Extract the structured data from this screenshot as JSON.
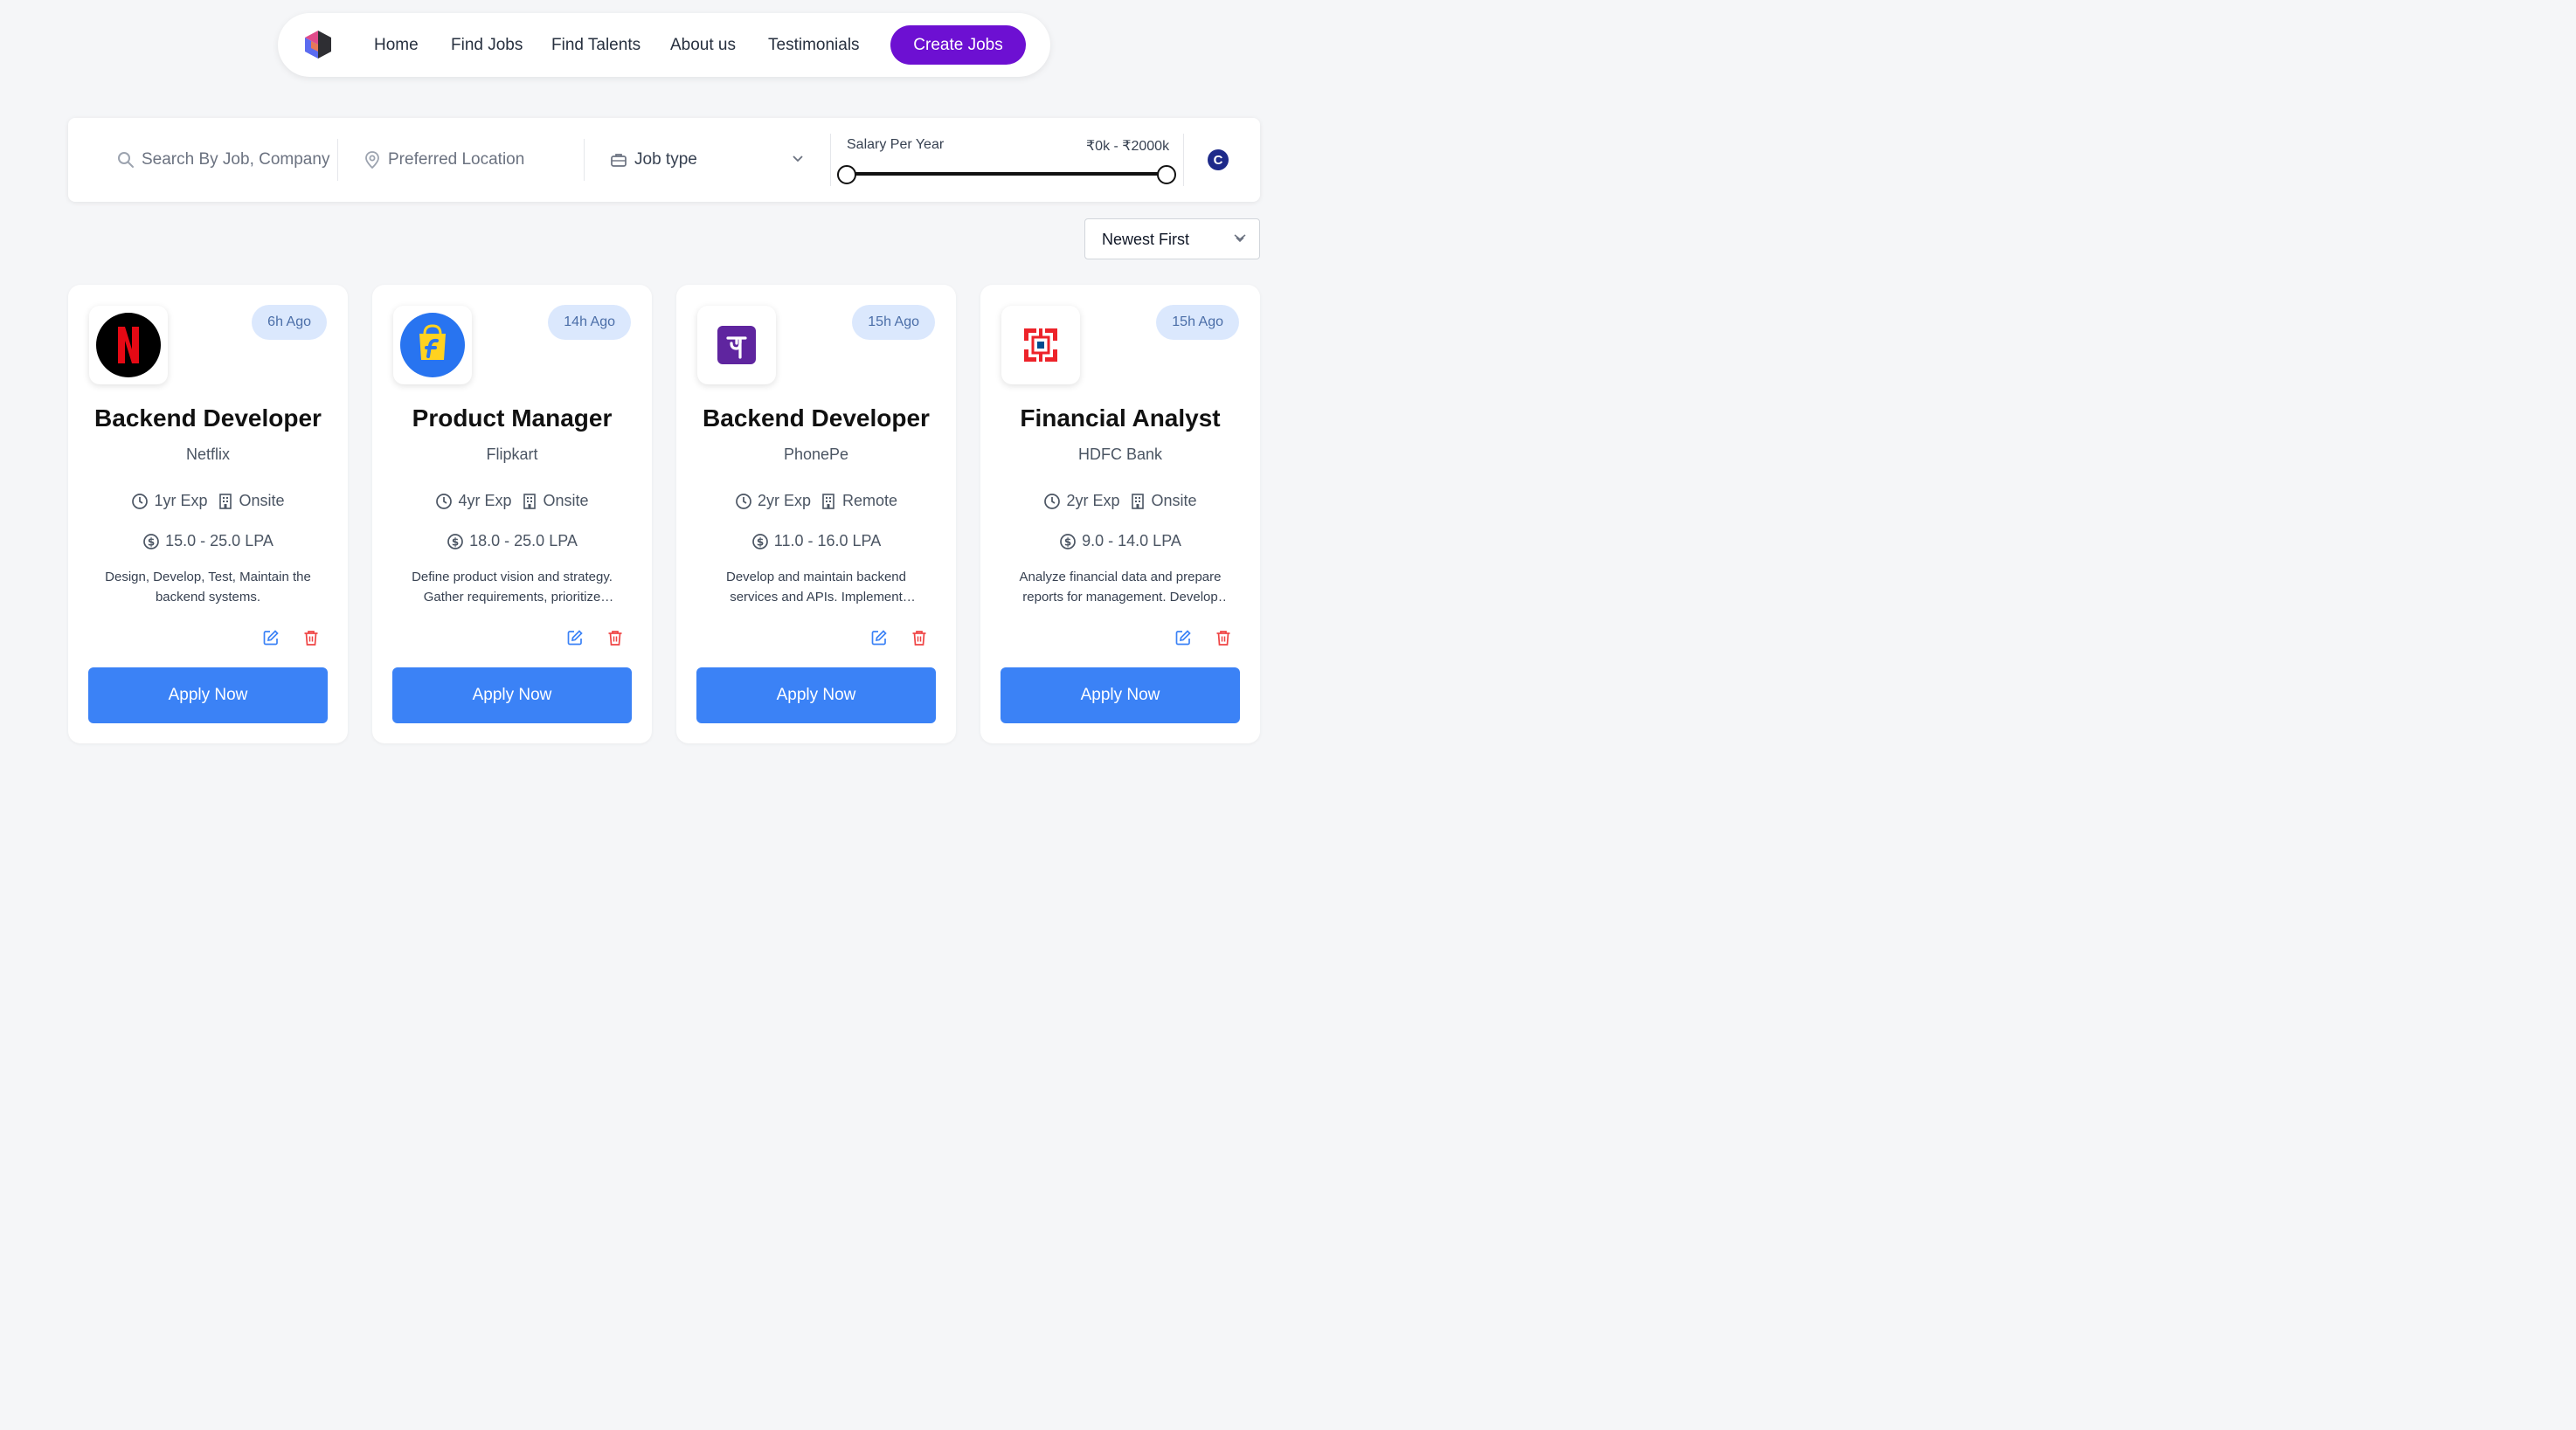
{
  "nav": {
    "links": [
      "Home",
      "Find Jobs",
      "Find Talents",
      "About us",
      "Testimonials"
    ],
    "create_label": "Create Jobs",
    "accent": "#6d10d2"
  },
  "filters": {
    "search_placeholder": "Search By Job, Company",
    "location_placeholder": "Preferred Location",
    "job_type_label": "Job type",
    "salary_label": "Salary Per Year",
    "salary_range": "₹0k - ₹2000k",
    "salary_min_fraction": 0,
    "salary_max_fraction": 1,
    "reset_icon": "C"
  },
  "sort": {
    "selected": "Newest First"
  },
  "jobs": [
    {
      "logo": "netflix-logo",
      "posted": "6h Ago",
      "title": "Backend Developer",
      "company": "Netflix",
      "experience": "1yr Exp",
      "work_mode": "Onsite",
      "salary": "15.0 - 25.0 LPA",
      "description": "Design, Develop, Test, Maintain the backend systems.",
      "apply_label": "Apply Now"
    },
    {
      "logo": "flipkart-logo",
      "posted": "14h Ago",
      "title": "Product Manager",
      "company": "Flipkart",
      "experience": "4yr Exp",
      "work_mode": "Onsite",
      "salary": "18.0 - 25.0 LPA",
      "description": "Define product vision and strategy. Gather requirements, prioritize features and coordinate releases.",
      "apply_label": "Apply Now"
    },
    {
      "logo": "phonepe-logo",
      "posted": "15h Ago",
      "title": "Backend Developer",
      "company": "PhonePe",
      "experience": "2yr Exp",
      "work_mode": "Remote",
      "salary": "11.0 - 16.0 LPA",
      "description": "Develop and maintain backend services and APIs. Implement scalable and secure systems.",
      "apply_label": "Apply Now"
    },
    {
      "logo": "hdfc-logo",
      "posted": "15h Ago",
      "title": "Financial Analyst",
      "company": "HDFC Bank",
      "experience": "2yr Exp",
      "work_mode": "Onsite",
      "salary": "9.0 - 14.0 LPA",
      "description": "Analyze financial data and prepare reports for management. Develop forecasting models.",
      "apply_label": "Apply Now"
    }
  ]
}
